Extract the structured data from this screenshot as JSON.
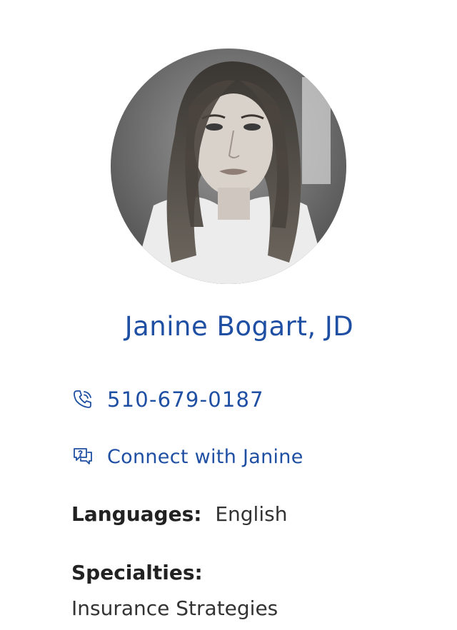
{
  "profile": {
    "avatar_alt": "Janine Bogart profile photo",
    "name": "Janine Bogart, JD"
  },
  "contact": {
    "phone_icon": "phone-icon",
    "phone": "510-679-0187",
    "connect_icon": "chat-question-icon",
    "connect_label": "Connect with Janine"
  },
  "details": {
    "languages_label": "Languages:",
    "languages_value": "English",
    "specialties_label": "Specialties:",
    "specialties_value": "Insurance Strategies"
  },
  "colors": {
    "accent": "#1f4fa3",
    "text": "#2b2b2b"
  }
}
